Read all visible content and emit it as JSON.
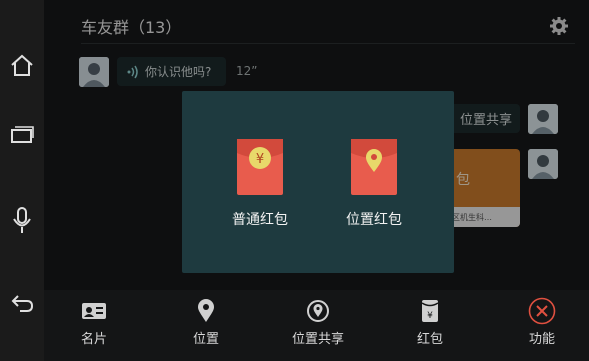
{
  "sidebar": {
    "items": [
      {
        "icon": "home-icon"
      },
      {
        "icon": "windows-icon"
      },
      {
        "icon": "microphone-icon"
      },
      {
        "icon": "back-icon"
      }
    ]
  },
  "header": {
    "title": "车友群（13）",
    "settings_icon": "gear-icon"
  },
  "chat": {
    "voice_message": {
      "text": "你认识他吗?",
      "duration": "12”"
    },
    "share_message": {
      "text": "位置共享"
    },
    "card_message": {
      "title": "包",
      "subtitle": "区机生科…"
    }
  },
  "dialog": {
    "items": [
      {
        "label": "普通红包",
        "icon": "yuan-icon"
      },
      {
        "label": "位置红包",
        "icon": "location-pin-icon"
      }
    ]
  },
  "bottom_bar": {
    "items": [
      {
        "label": "名片",
        "icon": "contact-card-icon"
      },
      {
        "label": "位置",
        "icon": "location-icon"
      },
      {
        "label": "位置共享",
        "icon": "location-share-icon"
      },
      {
        "label": "红包",
        "icon": "red-packet-icon"
      },
      {
        "label": "功能",
        "icon": "close-icon"
      }
    ]
  },
  "colors": {
    "dialog_bg": "#1e3a3f",
    "envelope": "#e85c4d",
    "coin": "#e8d86a",
    "close_accent": "#e05040"
  }
}
